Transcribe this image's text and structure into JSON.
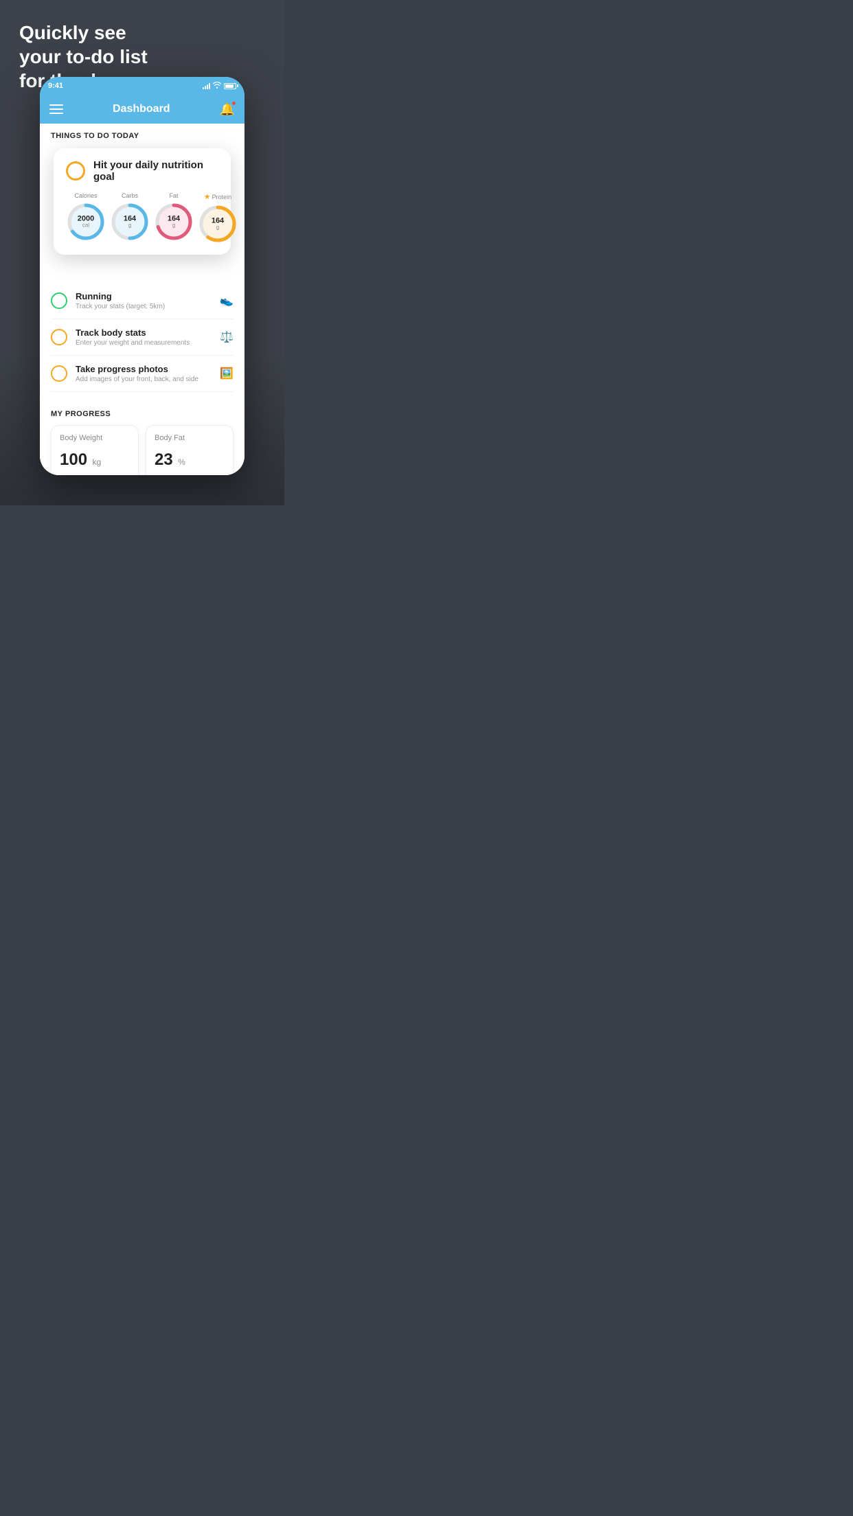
{
  "hero": {
    "line1": "Quickly see",
    "line2": "your to-do list",
    "line3": "for the day."
  },
  "phone": {
    "statusBar": {
      "time": "9:41",
      "signal": "signal",
      "wifi": "wifi",
      "battery": "battery"
    },
    "navBar": {
      "title": "Dashboard",
      "menu": "menu",
      "bell": "bell"
    },
    "sectionHeader": "THINGS TO DO TODAY",
    "nutritionCard": {
      "title": "Hit your daily nutrition goal",
      "items": [
        {
          "label": "Calories",
          "value": "2000",
          "unit": "cal",
          "color": "#5ab8e8",
          "bg": "#e8f5fb",
          "percent": 65,
          "star": false
        },
        {
          "label": "Carbs",
          "value": "164",
          "unit": "g",
          "color": "#5ab8e8",
          "bg": "#e8f5fb",
          "percent": 50,
          "star": false
        },
        {
          "label": "Fat",
          "value": "164",
          "unit": "g",
          "color": "#e05a7a",
          "bg": "#fce8ee",
          "percent": 70,
          "star": false
        },
        {
          "label": "Protein",
          "value": "164",
          "unit": "g",
          "color": "#f5a623",
          "bg": "#fdf3e3",
          "percent": 60,
          "star": true
        }
      ]
    },
    "todoItems": [
      {
        "title": "Running",
        "subtitle": "Track your stats (target: 5km)",
        "circleColor": "green",
        "icon": "shoe"
      },
      {
        "title": "Track body stats",
        "subtitle": "Enter your weight and measurements",
        "circleColor": "yellow",
        "icon": "scale"
      },
      {
        "title": "Take progress photos",
        "subtitle": "Add images of your front, back, and side",
        "circleColor": "yellow",
        "icon": "person"
      }
    ],
    "progressSection": {
      "header": "MY PROGRESS",
      "cards": [
        {
          "title": "Body Weight",
          "value": "100",
          "unit": "kg"
        },
        {
          "title": "Body Fat",
          "value": "23",
          "unit": "%"
        }
      ]
    }
  }
}
